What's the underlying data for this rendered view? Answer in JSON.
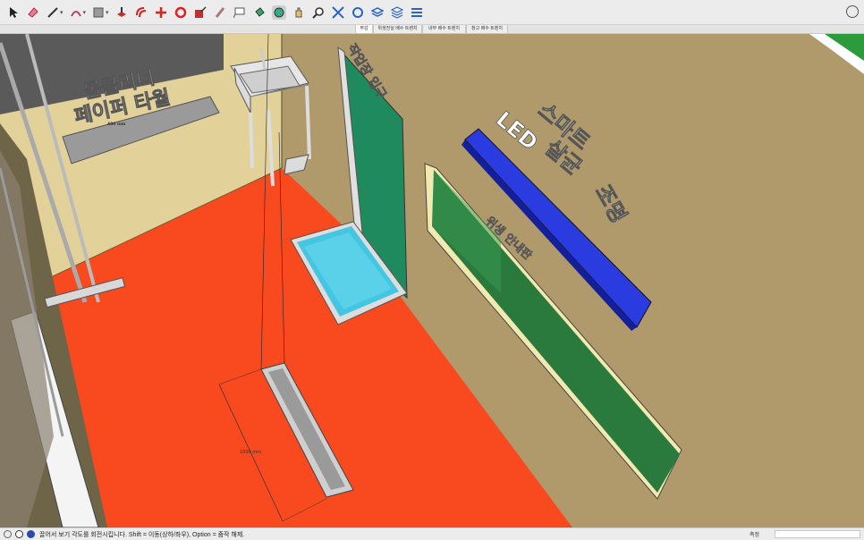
{
  "toolbar": {
    "tools": [
      {
        "name": "select-tool-icon"
      },
      {
        "name": "eraser-tool-icon"
      },
      {
        "name": "line-tool-icon",
        "dropdown": true
      },
      {
        "name": "arc-tool-icon",
        "dropdown": true
      },
      {
        "name": "shape-tool-icon",
        "dropdown": true
      },
      {
        "name": "push-pull-tool-icon"
      },
      {
        "name": "offset-tool-icon"
      },
      {
        "name": "move-tool-icon"
      },
      {
        "name": "rotate-tool-icon"
      },
      {
        "name": "scale-tool-icon"
      },
      {
        "name": "tape-measure-tool-icon"
      },
      {
        "name": "text-tool-icon"
      },
      {
        "name": "paint-bucket-tool-icon"
      },
      {
        "name": "orbit-tool-icon",
        "active": true
      },
      {
        "name": "pan-tool-icon"
      },
      {
        "name": "zoom-tool-icon"
      },
      {
        "name": "zoom-extents-tool-icon"
      },
      {
        "name": "warehouse-tool-icon"
      },
      {
        "name": "layers-tool-icon"
      },
      {
        "name": "extension-tool-icon"
      },
      {
        "name": "sections-tool-icon"
      }
    ],
    "profile_icon": "user-profile-icon"
  },
  "scene_tabs": [
    {
      "label": "부감",
      "active": true
    },
    {
      "label": "위생전실 배수 트렌치",
      "active": false
    },
    {
      "label": "내부 배수 트렌치",
      "active": false
    },
    {
      "label": "창고 배수 트렌치",
      "active": false
    }
  ],
  "model": {
    "signs": {
      "roll_cleaner": "롤클리너",
      "paper_tile": "페이퍼 타월",
      "led": "LED",
      "smart": "스마트",
      "sterilize": "살균",
      "light": "조명",
      "door_sign": "작업장 입구",
      "board_sign": "위생 안내판"
    },
    "dimensions": {
      "shelf": "400 mm",
      "trench": "1000 mm"
    }
  },
  "colors": {
    "floor": "#f8491f",
    "wall_right": "#b09a6c",
    "wall_back": "#e2d29a",
    "door_green": "#1f8a5e",
    "blue_light": "#2a3be0",
    "water": "#43c6e2",
    "board_green": "#2a7a3e"
  },
  "status": {
    "text": "끌어서 보기 각도를 회전시킵니다. Shift = 이동(상하/좌우), Option = 줌작 해제.",
    "measurements_label": "측정",
    "measurements_value": ""
  }
}
